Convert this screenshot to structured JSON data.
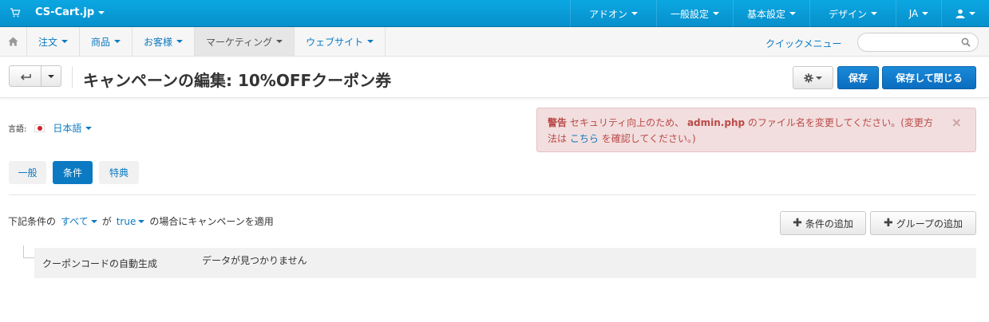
{
  "topbar": {
    "brand": "CS-Cart.jp",
    "nav": [
      "アドオン",
      "一般設定",
      "基本設定",
      "デザイン",
      "JA"
    ],
    "colors": {
      "bar": "#0b9fdc"
    }
  },
  "subbar": {
    "nav": [
      "注文",
      "商品",
      "お客様",
      "マーケティング",
      "ウェブサイト"
    ],
    "active": "マーケティング",
    "quick_menu": "クイックメニュー",
    "search_placeholder": ""
  },
  "titlebar": {
    "title": "キャンペーンの編集: 10%OFFクーポン券",
    "save": "保存",
    "save_close": "保存して閉じる"
  },
  "language": {
    "label": "言語:",
    "value": "日本語"
  },
  "alert": {
    "label": "警告",
    "text1": "セキュリティ向上のため、",
    "filename": "admin.php",
    "text2": "のファイル名を変更してください。(変更方法は",
    "link": "こちら",
    "text3": "を確認してください。)",
    "close": "×"
  },
  "tabs": [
    {
      "label": "一般",
      "active": false
    },
    {
      "label": "条件",
      "active": true
    },
    {
      "label": "特典",
      "active": false
    }
  ],
  "conditions": {
    "prefix": "下記条件の",
    "scope": "すべて",
    "middle": "が",
    "value": "true",
    "suffix": "の場合にキャンペーンを適用",
    "add_condition": "条件の追加",
    "add_group": "グループの追加",
    "items": [
      {
        "name": "クーポンコードの自動生成",
        "value": "データが見つかりません"
      }
    ]
  },
  "colors": {
    "link": "#0b7ac2",
    "primary": "#0b6cbf",
    "alert_bg": "#f2dede",
    "alert_text": "#b94a48"
  }
}
